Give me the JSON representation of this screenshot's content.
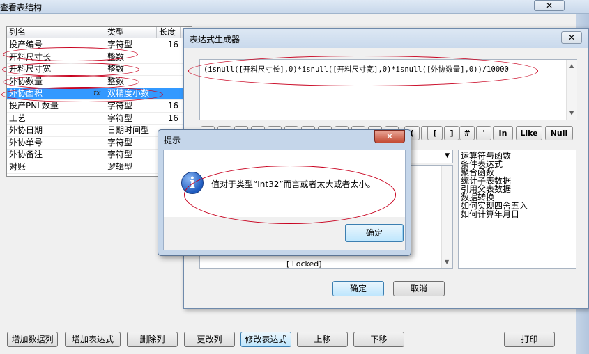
{
  "main": {
    "title": "查看表结构",
    "close_glyph": "✕",
    "grid": {
      "headers": [
        "列名",
        "类型",
        "长度",
        "长"
      ],
      "rows": [
        {
          "name": "投产编号",
          "type": "字符型",
          "length": "16"
        },
        {
          "name": "开料尺寸长",
          "type": "整数",
          "length": ""
        },
        {
          "name": "开料尺寸宽",
          "type": "整数",
          "length": ""
        },
        {
          "name": "外协数量",
          "type": "整数",
          "length": ""
        },
        {
          "name": "外协面积",
          "type": "双精度小数",
          "length": "",
          "selected": true,
          "fx": "fx"
        },
        {
          "name": "投产PNL数量",
          "type": "字符型",
          "length": "16"
        },
        {
          "name": "工艺",
          "type": "字符型",
          "length": "16"
        },
        {
          "name": "外协日期",
          "type": "日期时间型",
          "length": ""
        },
        {
          "name": "外协单号",
          "type": "字符型",
          "length": ""
        },
        {
          "name": "外协备注",
          "type": "字符型",
          "length": ""
        },
        {
          "name": "对账",
          "type": "逻辑型",
          "length": ""
        }
      ]
    },
    "buttons": {
      "add_column": "增加数据列",
      "add_expression": "增加表达式",
      "delete_column": "删除列",
      "change_column": "更改列",
      "modify_expression": "修改表达式",
      "move_up": "上移",
      "move_down": "下移",
      "print": "打印"
    }
  },
  "expression_builder": {
    "title": "表达式生成器",
    "close_glyph": "✕",
    "expression": "(isnull([开料尺寸长],0)*isnull([开料尺寸宽],0)*isnull([外协数量],0))/10000",
    "operators": [
      "(",
      ")",
      "[",
      "]",
      "#",
      "'",
      "In",
      "Like",
      "Null"
    ],
    "field_list_items": [
      "[ Locked]"
    ],
    "categories": [
      "运算符与函数",
      "条件表达式",
      "聚合函数",
      "统计子表数据",
      "引用父表数据",
      "数据转换",
      "如何实现四舍五入",
      "如何计算年月日"
    ],
    "ok": "确定",
    "cancel": "取消"
  },
  "message_box": {
    "title": "提示",
    "close_glyph": "✕",
    "icon_glyph": "i",
    "text": "值对于类型“Int32”而言或者太大或者太小。",
    "ok": "确定"
  },
  "annotation_color": "#c8001e"
}
